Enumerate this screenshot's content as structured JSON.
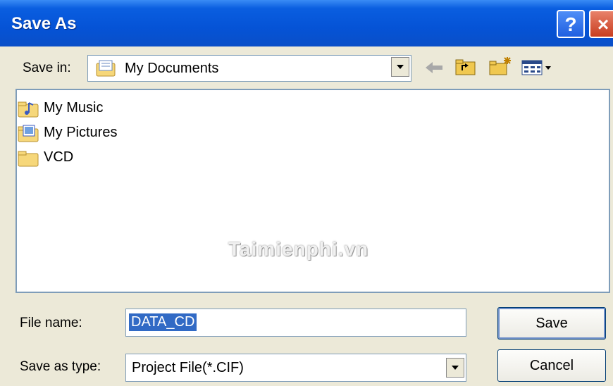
{
  "window": {
    "title": "Save As",
    "help_label": "?",
    "close_label": "×"
  },
  "toolbar": {
    "save_in_label": "Save in:",
    "save_in_value": "My Documents"
  },
  "files": [
    {
      "name": "My Music",
      "icon": "music-folder-icon"
    },
    {
      "name": "My Pictures",
      "icon": "pictures-folder-icon"
    },
    {
      "name": "VCD",
      "icon": "folder-icon"
    }
  ],
  "watermark": "Taimienphi.vn",
  "form": {
    "file_name_label": "File name:",
    "file_name_value": "DATA_CD",
    "save_type_label": "Save as type:",
    "save_type_value": "Project File(*.CIF)",
    "save_button": "Save",
    "cancel_button": "Cancel"
  }
}
